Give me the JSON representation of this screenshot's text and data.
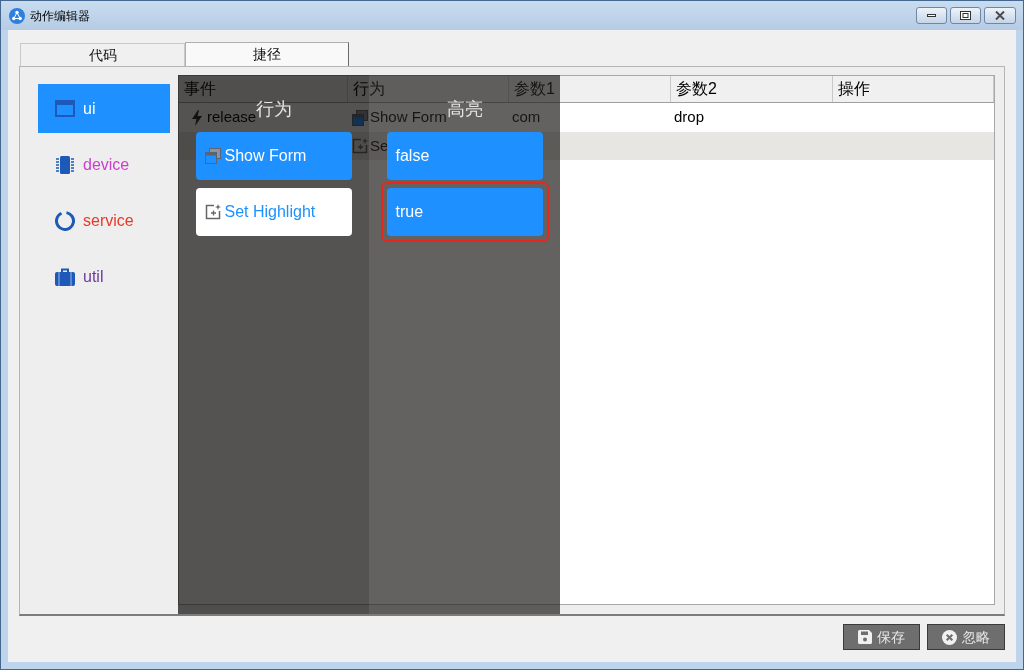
{
  "window": {
    "title": "动作编辑器"
  },
  "tabs": [
    {
      "label": "代码",
      "selected": false
    },
    {
      "label": "捷径",
      "selected": true
    }
  ],
  "sidebar": {
    "items": [
      {
        "label": "ui",
        "selected": true
      },
      {
        "label": "device",
        "selected": false,
        "color": "#cc3fcc"
      },
      {
        "label": "service",
        "selected": false,
        "color": "#e8392a"
      },
      {
        "label": "util",
        "selected": false,
        "color": "#6a3b9e"
      }
    ]
  },
  "table": {
    "columns": [
      "事件",
      "行为",
      "参数1",
      "参数2",
      "操作"
    ],
    "rows": [
      {
        "selected": false,
        "event": "release",
        "action": "Show Form",
        "param_1": "com",
        "param_2": "drop"
      },
      {
        "selected": true,
        "action": "Se"
      }
    ]
  },
  "picker": {
    "columns": [
      {
        "title": "行为",
        "options": [
          {
            "label": "Show Form",
            "selected": true,
            "focused": false
          },
          {
            "label": "Set Highlight",
            "selected": false,
            "focused": false
          }
        ]
      },
      {
        "title": "高亮",
        "options": [
          {
            "label": "false",
            "selected": true,
            "focused": false
          },
          {
            "label": "true",
            "selected": true,
            "focused": true
          }
        ]
      }
    ]
  },
  "buttons": [
    {
      "label": "保存"
    },
    {
      "label": "忽略"
    }
  ]
}
